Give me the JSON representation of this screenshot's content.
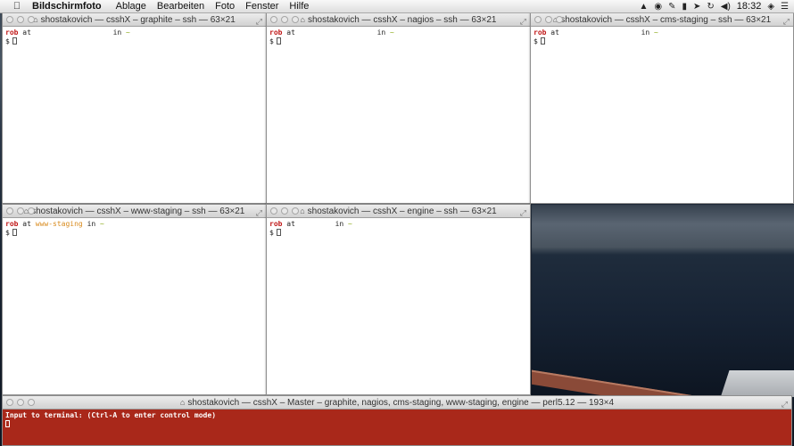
{
  "menubar": {
    "apple": "",
    "app_name": "Bildschirmfoto",
    "items": [
      "Ablage",
      "Bearbeiten",
      "Foto",
      "Fenster",
      "Hilfe"
    ],
    "status_icons": [
      "dropbox-icon",
      "evernote-icon",
      "pen-icon",
      "bookmark-icon",
      "location-icon",
      "time-machine-icon",
      "volume-icon"
    ],
    "clock": "18:32",
    "wifi_icon": "wifi-icon",
    "list_icon": "list-icon"
  },
  "terminals": [
    {
      "title": "shostakovich — csshX – graphite – ssh — 63×21",
      "user": "rob",
      "at": "at",
      "host": "",
      "in": "in",
      "dir": "~",
      "prompt": "$"
    },
    {
      "title": "shostakovich — csshX – nagios – ssh — 63×21",
      "user": "rob",
      "at": "at",
      "host": "",
      "in": "in",
      "dir": "~",
      "prompt": "$"
    },
    {
      "title": "shostakovich — csshX – cms-staging – ssh — 63×21",
      "user": "rob",
      "at": "at",
      "host": "",
      "in": "in",
      "dir": "~",
      "prompt": "$"
    },
    {
      "title": "shostakovich — csshX – www-staging – ssh — 63×21",
      "user": "rob",
      "at": "at",
      "host": "www-staging",
      "in": "in",
      "dir": "~",
      "prompt": "$"
    },
    {
      "title": "shostakovich — csshX – engine – ssh — 63×21",
      "user": "rob",
      "at": "at",
      "host": "",
      "in": "in",
      "dir": "~",
      "prompt": "$"
    }
  ],
  "master": {
    "title": "shostakovich — csshX – Master – graphite, nagios, cms-staging, www-staging, engine — perl5.12 — 193×4",
    "line": "Input to terminal: (Ctrl-A to enter control mode)"
  },
  "colors": {
    "master_bg": "#a9281a",
    "user": "#c01818",
    "host": "#d88a1c",
    "dir": "#8caa1a"
  }
}
